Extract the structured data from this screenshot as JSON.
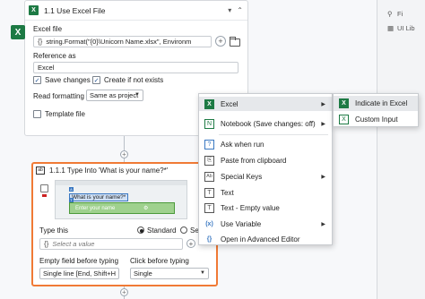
{
  "use_excel": {
    "title": "1.1 Use Excel File",
    "badge": "X",
    "excel_file_label": "Excel file",
    "excel_file_value": "string.Format(\"{0}\\Unicorn Name.xlsx\", Environm",
    "reference_as_label": "Reference as",
    "reference_as_value": "Excel",
    "save_changes_label": "Save changes",
    "save_changes_checked": true,
    "create_if_not_exists_label": "Create if not exists",
    "create_if_not_exists_checked": true,
    "read_formatting_label": "Read formatting",
    "read_formatting_value": "Same as project",
    "template_file_label": "Template file",
    "template_file_checked": false
  },
  "type_into": {
    "title": "1.1.1 Type Into 'What is your name?*'",
    "preview_label_text": "What is your name?*",
    "preview_input_placeholder": "Enter your name",
    "type_this_label": "Type this",
    "standard_label": "Standard",
    "standard_selected": true,
    "second_option_label": "Sec",
    "value_placeholder": "Select a value",
    "empty_field_label": "Empty field before typing",
    "empty_field_value": "Single line [End, Shift+H",
    "click_before_label": "Click before typing",
    "click_before_value": "Single"
  },
  "context_menu": {
    "items": [
      {
        "label": "Excel",
        "icon": "excel-icon",
        "submenu": true
      },
      {
        "label": "Notebook (Save changes: off)",
        "icon": "notebook-icon",
        "submenu": true
      },
      {
        "label": "Ask when run",
        "icon": "ask-icon",
        "submenu": false
      },
      {
        "label": "Paste from clipboard",
        "icon": "clipboard-icon",
        "submenu": false
      },
      {
        "label": "Special Keys",
        "icon": "keyboard-icon",
        "submenu": true
      },
      {
        "label": "Text",
        "icon": "text-icon",
        "submenu": false
      },
      {
        "label": "Text - Empty value",
        "icon": "text-empty-icon",
        "submenu": false
      },
      {
        "label": "Use Variable",
        "icon": "variable-icon",
        "submenu": true
      },
      {
        "label": "Open in Advanced Editor",
        "icon": "advanced-editor-icon",
        "submenu": false
      }
    ]
  },
  "submenu": {
    "items": [
      {
        "label": "Indicate in Excel",
        "icon": "indicate-icon"
      },
      {
        "label": "Custom Input",
        "icon": "custom-input-icon"
      }
    ]
  },
  "right_panel": {
    "search_text": "Fi",
    "item_1": "UI Lib"
  },
  "colors": {
    "excel_green": "#1d7a44",
    "selection_orange": "#f07a35",
    "highlight_blue": "#3a78c2",
    "highlight_green": "#9fd18e"
  }
}
